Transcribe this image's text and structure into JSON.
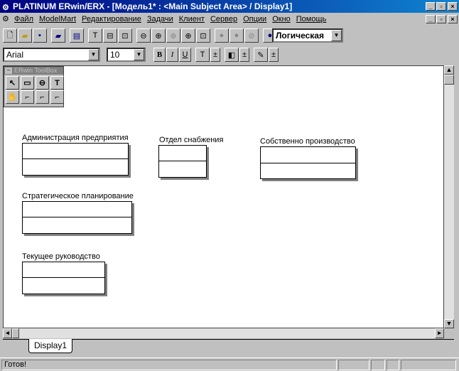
{
  "window": {
    "title": "PLATINUM ERwin/ERX - [Модель1* : <Main Subject Area> / Display1]"
  },
  "menu": [
    "Файл",
    "ModelMart",
    "Редактирование",
    "Задачи",
    "Клиент",
    "Сервер",
    "Опции",
    "Окно",
    "Помощь"
  ],
  "toolbar": {
    "view_mode": "Логическая"
  },
  "format_bar": {
    "font": "Arial",
    "size": "10",
    "bold": "B",
    "italic": "I",
    "underline": "U"
  },
  "toolbox": {
    "title": "ERwin ToolBox",
    "tools": [
      "↖",
      "▭",
      "⊖",
      "T",
      "✋",
      "⌐",
      "⌐",
      "⌐"
    ]
  },
  "entities": [
    {
      "name": "Администрация предприятия"
    },
    {
      "name": "Отдел снабжения"
    },
    {
      "name": "Собственно производство"
    },
    {
      "name": "Стратегическое планирование"
    },
    {
      "name": "Текущее руководство"
    }
  ],
  "tabs": [
    "Display1"
  ],
  "status": {
    "text": "Готов!"
  }
}
